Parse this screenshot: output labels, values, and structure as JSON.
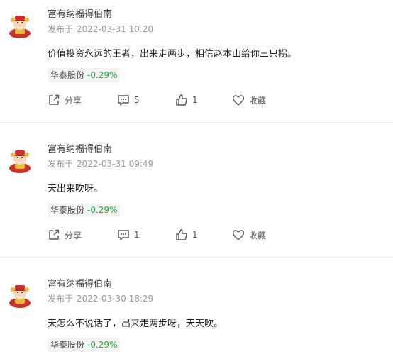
{
  "posts": [
    {
      "author": "富有纳福得伯南",
      "published_prefix": "发布于",
      "published_time": "2022-03-31 10:20",
      "content": "价值投资永远的王者，出来走两步，相信赵本山给你三只拐。",
      "stock": {
        "name": "华泰股份",
        "change": "-0.29%"
      },
      "actions": {
        "share": "分享",
        "comments": "5",
        "likes": "1",
        "favorite": "收藏"
      }
    },
    {
      "author": "富有纳福得伯南",
      "published_prefix": "发布于",
      "published_time": "2022-03-31 09:49",
      "content": "天出来吹呀。",
      "stock": {
        "name": "华泰股份",
        "change": "-0.29%"
      },
      "actions": {
        "share": "分享",
        "comments": "1",
        "likes": "1",
        "favorite": "收藏"
      }
    },
    {
      "author": "富有纳福得伯南",
      "published_prefix": "发布于",
      "published_time": "2022-03-30 18:29",
      "content": "天怎么不说话了，出来走两步呀，天天吹。",
      "stock": {
        "name": "华泰股份",
        "change": "-0.29%"
      }
    }
  ],
  "colors": {
    "stock_down": "#2aa544",
    "muted_text": "#9a9a9a",
    "divider": "#ececec"
  },
  "icons": [
    "avatar-caishen",
    "share-icon",
    "comment-icon",
    "like-icon",
    "heart-icon"
  ]
}
